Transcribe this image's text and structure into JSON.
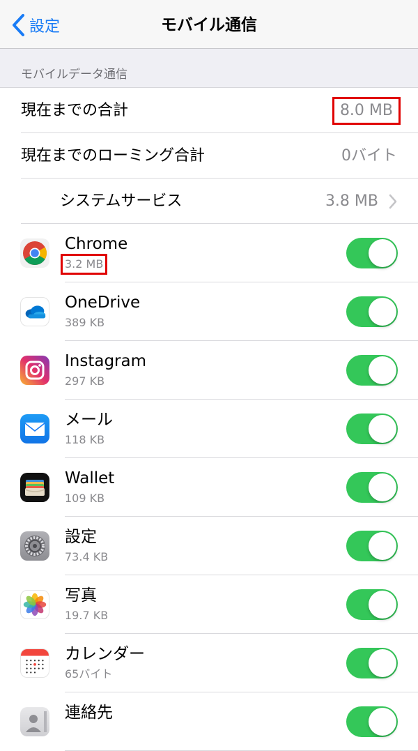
{
  "nav": {
    "back_label": "設定",
    "title": "モバイル通信"
  },
  "section": {
    "header": "モバイルデータ通信"
  },
  "summary": {
    "total_label": "現在までの合計",
    "total_value": "8.0 MB",
    "roaming_label": "現在までのローミング合計",
    "roaming_value": "0バイト",
    "system_label": "システムサービス",
    "system_value": "3.8 MB"
  },
  "apps": [
    {
      "name": "Chrome",
      "size": "3.2 MB",
      "icon": "chrome-icon",
      "enabled": true
    },
    {
      "name": "OneDrive",
      "size": "389 KB",
      "icon": "onedrive-icon",
      "enabled": true
    },
    {
      "name": "Instagram",
      "size": "297 KB",
      "icon": "instagram-icon",
      "enabled": true
    },
    {
      "name": "メール",
      "size": "118 KB",
      "icon": "mail-icon",
      "enabled": true
    },
    {
      "name": "Wallet",
      "size": "109 KB",
      "icon": "wallet-icon",
      "enabled": true
    },
    {
      "name": "設定",
      "size": "73.4 KB",
      "icon": "settings-gear-icon",
      "enabled": true
    },
    {
      "name": "写真",
      "size": "19.7 KB",
      "icon": "photos-icon",
      "enabled": true
    },
    {
      "name": "カレンダー",
      "size": "65バイト",
      "icon": "calendar-icon",
      "enabled": true
    },
    {
      "name": "連絡先",
      "size": "",
      "icon": "contacts-icon",
      "enabled": true
    }
  ],
  "colors": {
    "accent": "#1a7cf6",
    "toggle_on": "#34c759",
    "highlight": "#e00000"
  }
}
